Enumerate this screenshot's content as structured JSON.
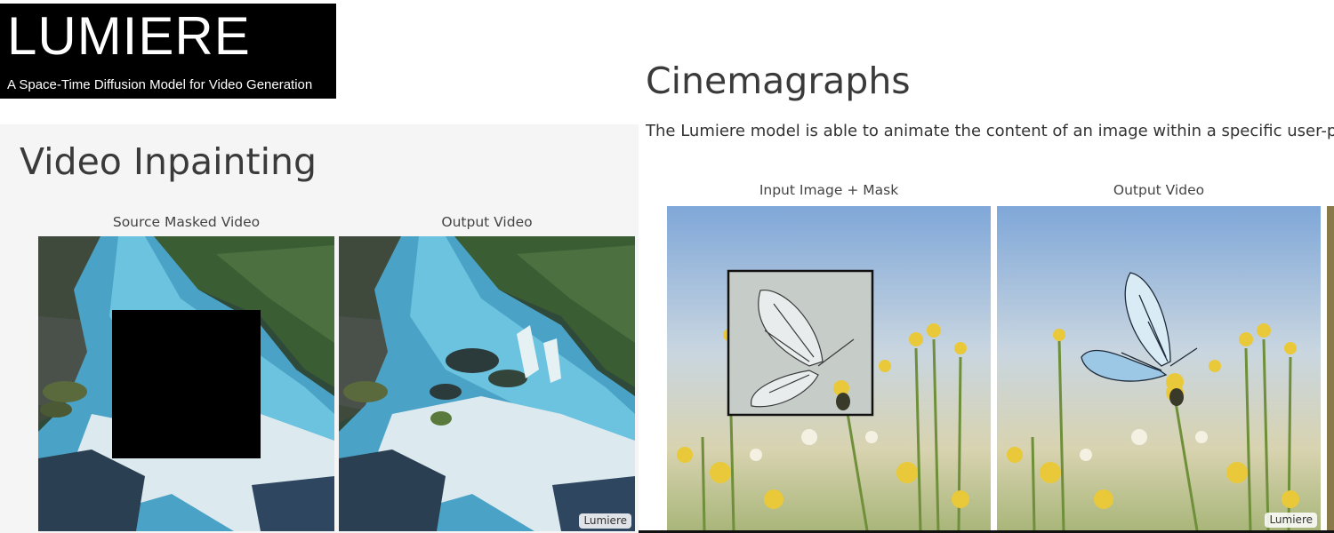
{
  "logo": {
    "title": "LUMIERE",
    "subtitle": "A Space-Time Diffusion Model for Video Generation"
  },
  "inpainting": {
    "title": "Video Inpainting",
    "source_label": "Source Masked Video",
    "output_label": "Output Video",
    "watermark": "Lumiere"
  },
  "cinemagraphs": {
    "title": "Cinemagraphs",
    "description": "The Lumiere model is able to animate the content of an image within a specific user-pr",
    "input_label": "Input Image + Mask",
    "output_label": "Output Video",
    "watermark": "Lumiere"
  },
  "colors": {
    "logo_bg": "#000000",
    "panel_bg": "#f5f5f5",
    "heading": "#3a3a3a"
  }
}
